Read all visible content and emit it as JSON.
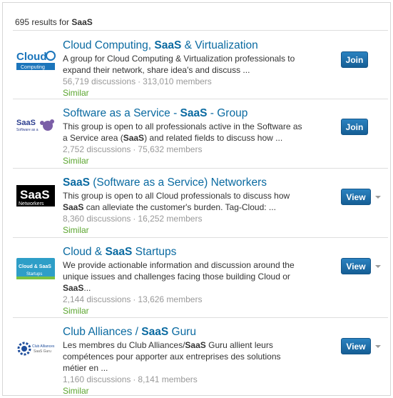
{
  "results": {
    "count": "695",
    "text": "results for",
    "query": "SaaS"
  },
  "groups": [
    {
      "title_pre": "Cloud Computing, ",
      "title_hl": "SaaS",
      "title_post": " & Virtualization",
      "desc": "A group for Cloud Computing & Virtualization professionals to expand their network, share idea's and discuss ...",
      "discussions": "56,719 discussions",
      "members": "313,010 members",
      "similar": "Similar",
      "action": "Join",
      "logo_text": "Cloud",
      "logo_sub": "Computing"
    },
    {
      "title_pre": "Software as a Service - ",
      "title_hl": "SaaS",
      "title_post": " - Group",
      "desc_pre": "This group is open to all professionals active in the Software as a Service area (",
      "desc_hl": "SaaS",
      "desc_post": ") and related fields to discuss how ...",
      "discussions": "2,752 discussions",
      "members": "75,632 members",
      "similar": "Similar",
      "action": "Join",
      "logo_text": "SaaS",
      "logo_sub": "Software as a"
    },
    {
      "title_pre": "",
      "title_hl": "SaaS",
      "title_post": " (Software as a Service) Networkers",
      "desc_pre": "This group is open to all Cloud professionals to discuss how ",
      "desc_hl": "SaaS",
      "desc_post": " can alleviate the customer's burden. Tag-Cloud: ...",
      "discussions": "8,360 discussions",
      "members": "16,252 members",
      "similar": "Similar",
      "action": "View",
      "logo_text": "SaaS",
      "logo_sub": "Networkers"
    },
    {
      "title_pre": "Cloud & ",
      "title_hl": "SaaS",
      "title_post": " Startups",
      "desc_pre": "We provide actionable information and discussion around the unique issues and challenges facing those building Cloud or ",
      "desc_hl": "SaaS",
      "desc_post": "...",
      "discussions": "2,144 discussions",
      "members": "13,626 members",
      "similar": "Similar",
      "action": "View",
      "logo_text": "Cloud & SaaS",
      "logo_sub": "Startups"
    },
    {
      "title_pre": "Club Alliances / ",
      "title_hl": "SaaS",
      "title_post": " Guru",
      "desc_pre": "Les membres du Club Alliances/",
      "desc_hl": "SaaS",
      "desc_post": " Guru allient leurs compétences pour apporter aux entreprises des solutions métier en ...",
      "discussions": "1,160 discussions",
      "members": "8,141 members",
      "similar": "Similar",
      "action": "View",
      "logo_text": "Club Alliances",
      "logo_sub": "SaaS Guru"
    }
  ],
  "dot": "·",
  "colors": {
    "link": "#0a6aa1",
    "similar": "#5ca630",
    "button": "#1f6fab"
  }
}
